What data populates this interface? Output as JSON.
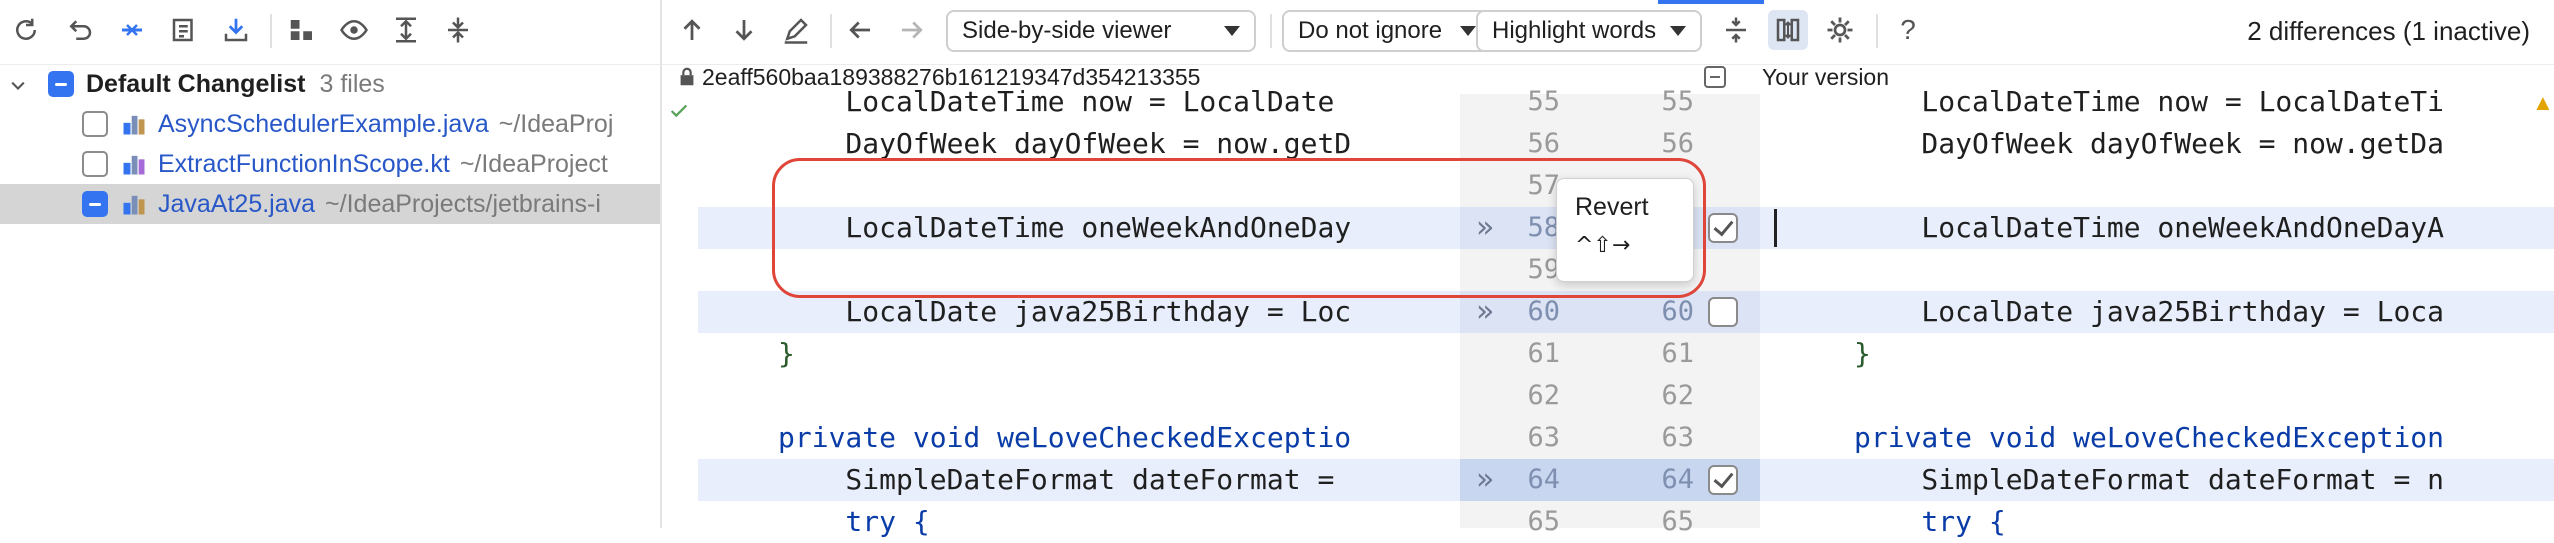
{
  "left_panel": {
    "changelist_name": "Default Changelist",
    "changelist_count": "3 files",
    "files": [
      {
        "name": "AsyncSchedulerExample.java",
        "path": "~/IdeaProj"
      },
      {
        "name": "ExtractFunctionInScope.kt",
        "path": "~/IdeaProject"
      },
      {
        "name": "JavaAt25.java",
        "path": "~/IdeaProjects/jetbrains-i"
      }
    ]
  },
  "diff_toolbar": {
    "viewer_select": "Side-by-side viewer",
    "ignore_select": "Do not ignore",
    "highlight_select": "Highlight words",
    "differences_status": "2 differences (1 inactive)",
    "help": "?"
  },
  "diff_header": {
    "left_revision": "2eaff560baa189388276b161219347d354213355",
    "right_title": "Your version"
  },
  "left_code": [
    "    LocalDateTime now = LocalDate",
    "    DayOfWeek dayOfWeek = now.getD",
    "",
    "    LocalDateTime oneWeekAndOneDay",
    "",
    "    LocalDate java25Birthday = Loc",
    "}",
    "",
    "private void weLoveCheckedExceptio",
    "    SimpleDateFormat dateFormat =",
    "    try {"
  ],
  "right_code": [
    "    LocalDateTime now = LocalDateTi",
    "    DayOfWeek dayOfWeek = now.getDa",
    "",
    "    LocalDateTime oneWeekAndOneDayA",
    "",
    "    LocalDate java25Birthday = Loca",
    "}",
    "",
    "private void weLoveCheckedException",
    "    SimpleDateFormat dateFormat = n",
    "    try {"
  ],
  "left_line_numbers": [
    "55",
    "56",
    "57",
    "58",
    "59",
    "60",
    "61",
    "62",
    "63",
    "64",
    "65"
  ],
  "right_line_numbers": [
    "55",
    "56",
    "",
    "",
    "",
    "60",
    "61",
    "62",
    "63",
    "64",
    "65"
  ],
  "popup": {
    "title": "Revert",
    "shortcut": "^⇧→"
  },
  "colors": {
    "accent": "#3574f0",
    "changed_line_bg": "#e8eefb",
    "gutter_bg": "#f3f3f3",
    "annotation_red": "#e0453a"
  }
}
